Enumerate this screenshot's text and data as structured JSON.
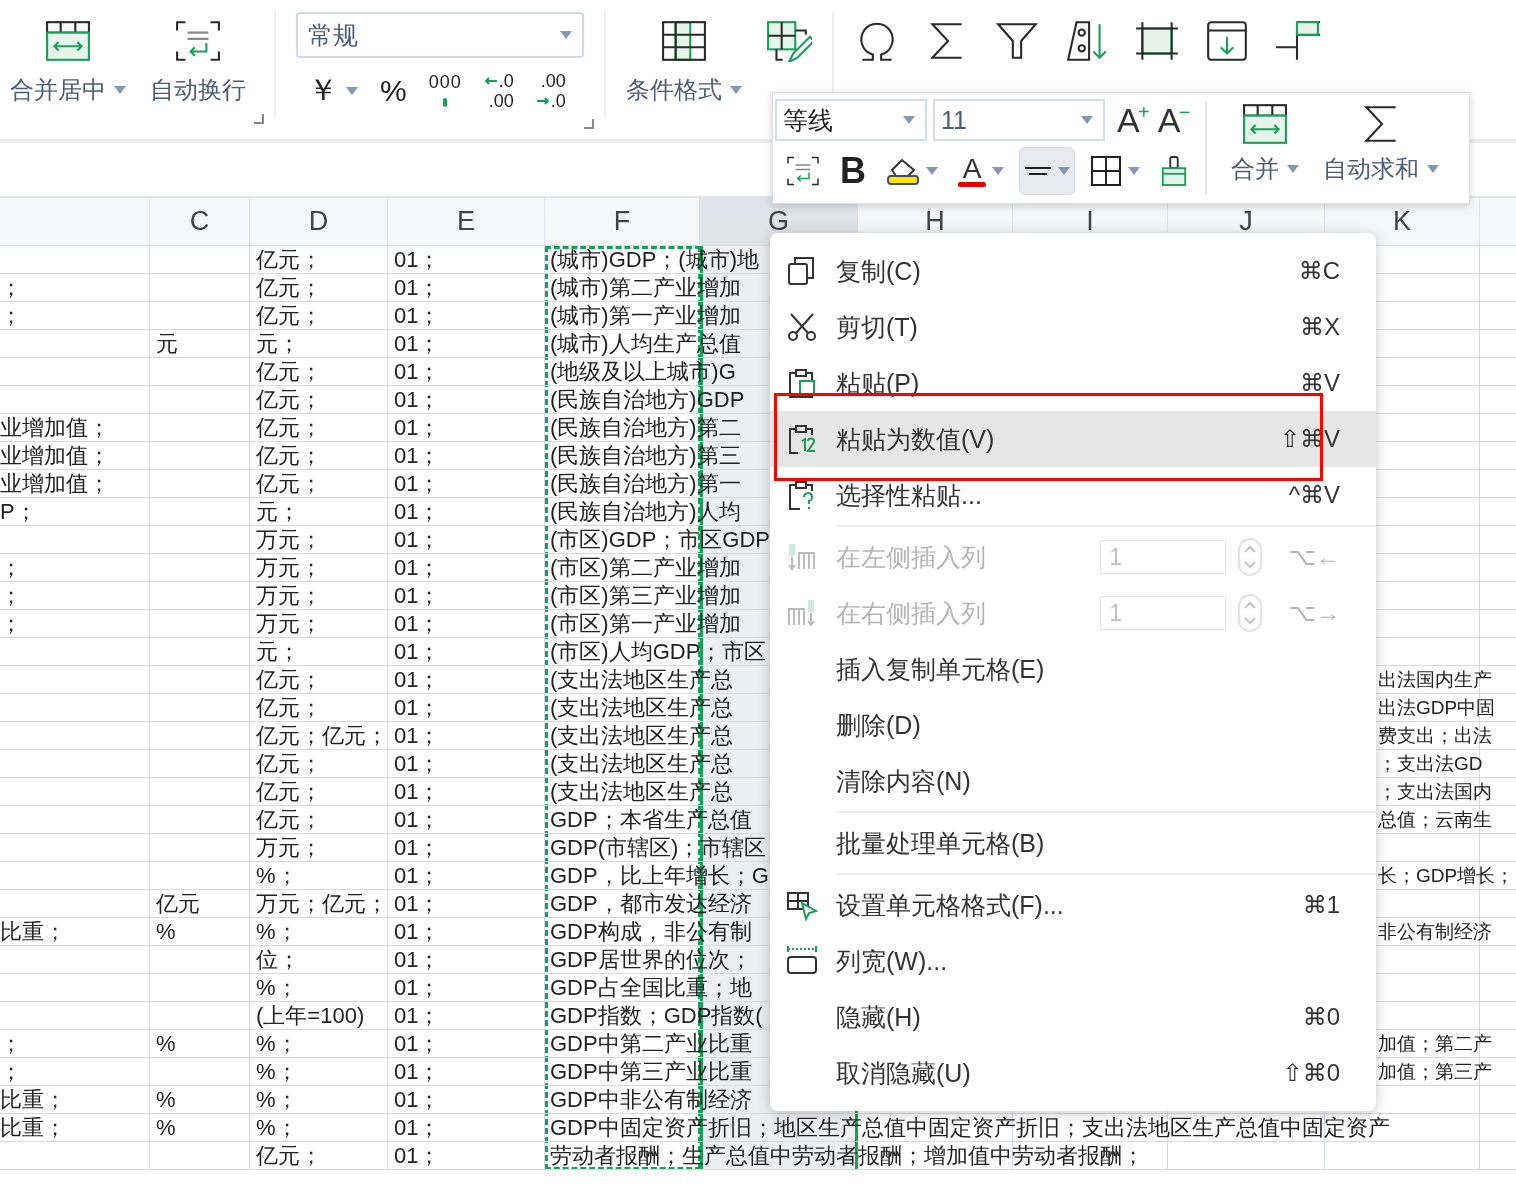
{
  "ribbon": {
    "left_buttons": [
      {
        "kind": "merge",
        "label": "合并居中",
        "dropdown": true
      },
      {
        "kind": "wrap",
        "label": "自动换行",
        "dropdown": false
      }
    ],
    "number_format": {
      "value": "常规",
      "buttons": [
        {
          "kind": "text",
          "text": "￥",
          "dropdown": true
        },
        {
          "kind": "text",
          "text": "%",
          "dropdown": false
        },
        {
          "kind": "thousands",
          "text": "000",
          "dropdown": false
        },
        {
          "kind": "decimal_add",
          "top": ".0",
          "bottom": ".00",
          "dropdown": false
        },
        {
          "kind": "decimal_remove",
          "top": ".00",
          "bottom": ".0",
          "dropdown": false
        }
      ]
    },
    "tools": [
      {
        "kind": "conditional",
        "label": "条件格式",
        "dropdown": true
      },
      {
        "kind": "table_style",
        "dropdown": false
      },
      {
        "kind": "symbol",
        "dropdown": false
      },
      {
        "kind": "sum",
        "dropdown": false
      },
      {
        "kind": "filter",
        "dropdown": false
      },
      {
        "kind": "sort",
        "dropdown": false
      },
      {
        "kind": "format",
        "dropdown": false
      },
      {
        "kind": "fill",
        "dropdown": false
      },
      {
        "kind": "rowcol",
        "dropdown": false
      }
    ]
  },
  "mini_toolbar": {
    "font": "等线",
    "size": "11",
    "size_buttons": [
      {
        "text": "A",
        "sign": "+"
      },
      {
        "text": "A",
        "sign": "−"
      }
    ],
    "tools": [
      {
        "kind": "wrap",
        "dropdown": false,
        "selected": false
      },
      {
        "kind": "bold",
        "text": "B",
        "dropdown": false,
        "selected": false
      },
      {
        "kind": "fill_color",
        "dropdown": true,
        "selected": false
      },
      {
        "kind": "font_color",
        "text": "A",
        "dropdown": true,
        "selected": false
      },
      {
        "kind": "align",
        "dropdown": true,
        "selected": true
      },
      {
        "kind": "borders",
        "dropdown": true,
        "selected": false
      },
      {
        "kind": "painter",
        "dropdown": false,
        "selected": false
      }
    ],
    "big_buttons": [
      {
        "kind": "merge",
        "label": "合并",
        "dropdown": true
      },
      {
        "kind": "sum",
        "label": "自动求和",
        "dropdown": true
      }
    ]
  },
  "sheet": {
    "columns": [
      {
        "label": "C",
        "selected": false,
        "copied": false
      },
      {
        "label": "D",
        "selected": false,
        "copied": false
      },
      {
        "label": "E",
        "selected": false,
        "copied": false
      },
      {
        "label": "F",
        "selected": false,
        "copied": true
      },
      {
        "label": "G",
        "selected": true,
        "copied": false
      },
      {
        "label": "H",
        "selected": false,
        "copied": false
      },
      {
        "label": "I",
        "selected": false,
        "copied": false
      },
      {
        "label": "J",
        "selected": false,
        "copied": false
      },
      {
        "label": "K",
        "selected": false,
        "copied": false
      }
    ],
    "rows": [
      {
        "d": "亿元；",
        "e": "01；",
        "f": "(城市)GDP；(城市)地"
      },
      {
        "b": "；",
        "d": "亿元；",
        "e": "01；",
        "f": "(城市)第二产业增加"
      },
      {
        "b": "；",
        "d": "亿元；",
        "e": "01；",
        "f": "(城市)第一产业增加"
      },
      {
        "c": "元",
        "d": "元；",
        "e": "01；",
        "f": "(城市)人均生产总值"
      },
      {
        "d": "亿元；",
        "e": "01；",
        "f": "(地级及以上城市)G"
      },
      {
        "d": "亿元；",
        "e": "01；",
        "f": "(民族自治地方)GDP"
      },
      {
        "b": "业增加值；",
        "d": "亿元；",
        "e": "01；",
        "f": "(民族自治地方)第二"
      },
      {
        "b": "业增加值；",
        "d": "亿元；",
        "e": "01；",
        "f": "(民族自治地方)第三"
      },
      {
        "b": "业增加值；",
        "d": "亿元；",
        "e": "01；",
        "f": "(民族自治地方)第一"
      },
      {
        "b": "P；",
        "d": "元；",
        "e": "01；",
        "f": "(民族自治地方)人均"
      },
      {
        "d": "万元；",
        "e": "01；",
        "f": "(市区)GDP；市区GDP"
      },
      {
        "b": "；",
        "d": "万元；",
        "e": "01；",
        "f": "(市区)第二产业增加"
      },
      {
        "b": "；",
        "d": "万元；",
        "e": "01；",
        "f": "(市区)第三产业增加"
      },
      {
        "b": "；",
        "d": "万元；",
        "e": "01；",
        "f": "(市区)第一产业增加"
      },
      {
        "d": "元；",
        "e": "01；",
        "f": "(市区)人均GDP；市区"
      },
      {
        "d": "亿元；",
        "e": "01；",
        "f": "(支出法地区生产总",
        "k": "出法国内生产"
      },
      {
        "d": "亿元；",
        "e": "01；",
        "f": "(支出法地区生产总",
        "k": "出法GDP中固"
      },
      {
        "d": "亿元；亿元；",
        "e": "01；",
        "f": "(支出法地区生产总",
        "k": "费支出；出法"
      },
      {
        "d": "亿元；",
        "e": "01；",
        "f": "(支出法地区生产总",
        "k": "；支出法GD"
      },
      {
        "d": "亿元；",
        "e": "01；",
        "f": "(支出法地区生产总",
        "k": "；支出法国内"
      },
      {
        "d": "亿元；",
        "e": "01；",
        "f": "GDP；本省生产总值",
        "k": "总值；云南生"
      },
      {
        "d": "万元；",
        "e": "01；",
        "f": "GDP(市辖区)；市辖区"
      },
      {
        "d": "%；",
        "e": "01；",
        "f": "GDP，比上年增长；G",
        "k": "长；GDP增长；"
      },
      {
        "c": "亿元",
        "d": "万元；亿元；",
        "e": "01；",
        "f": "GDP，都市发达经济"
      },
      {
        "b": "比重；",
        "c": "%",
        "d": "%；",
        "e": "01；",
        "f": "GDP构成，非公有制",
        "k": "非公有制经济"
      },
      {
        "d": "位；",
        "e": "01；",
        "f": "GDP居世界的位次；"
      },
      {
        "d": "%；",
        "e": "01；",
        "f": "GDP占全国比重；地"
      },
      {
        "d": "(上年=100)",
        "e": "01；",
        "f": "GDP指数；GDP指数("
      },
      {
        "b": "；",
        "c": "%",
        "d": "%；",
        "e": "01；",
        "f": "GDP中第二产业比重",
        "k": "加值；第二产"
      },
      {
        "b": "；",
        "d": "%；",
        "e": "01；",
        "f": "GDP中第三产业比重",
        "k": "加值；第三产"
      },
      {
        "b": "比重；",
        "c": "%",
        "d": "%；",
        "e": "01；",
        "f": "GDP中非公有制经济"
      },
      {
        "b": "比重；",
        "c": "%",
        "d": "%；",
        "e": "01；",
        "f": "GDP中固定资产折旧；地区生产总值中固定资产折旧；支出法地区生产总值中固定资产"
      },
      {
        "d": "亿元；",
        "e": "01；",
        "f": "劳动者报酬；生产总值中劳动者报酬；增加值中劳动者报酬；"
      }
    ]
  },
  "context_menu": {
    "items": [
      {
        "kind": "copy",
        "label": "复制(C)",
        "shortcut": "⌘C",
        "selected": false,
        "disabled": false,
        "separator_above": false
      },
      {
        "kind": "cut",
        "label": "剪切(T)",
        "shortcut": "⌘X",
        "selected": false,
        "disabled": false,
        "separator_above": false
      },
      {
        "kind": "paste",
        "label": "粘贴(P)",
        "shortcut": "⌘V",
        "selected": false,
        "disabled": false,
        "separator_above": false
      },
      {
        "kind": "paste_values",
        "label": "粘贴为数值(V)",
        "shortcut": "⇧⌘V",
        "selected": true,
        "disabled": false,
        "separator_above": false
      },
      {
        "kind": "paste_special",
        "label": "选择性粘贴...",
        "shortcut": "^⌘V",
        "selected": false,
        "disabled": false,
        "separator_above": false
      },
      {
        "kind": "insert_left",
        "label": "在左侧插入列",
        "value": "1",
        "shortcut": "⌥←",
        "selected": false,
        "disabled": true,
        "separator_above": true
      },
      {
        "kind": "insert_right",
        "label": "在右侧插入列",
        "value": "1",
        "shortcut": "⌥→",
        "selected": false,
        "disabled": true,
        "separator_above": false
      },
      {
        "kind": "plain",
        "label": "插入复制单元格(E)",
        "selected": false,
        "disabled": false,
        "separator_above": false
      },
      {
        "kind": "plain",
        "label": "删除(D)",
        "selected": false,
        "disabled": false,
        "separator_above": false
      },
      {
        "kind": "plain",
        "label": "清除内容(N)",
        "selected": false,
        "disabled": false,
        "separator_above": false
      },
      {
        "kind": "plain",
        "label": "批量处理单元格(B)",
        "selected": false,
        "disabled": false,
        "separator_above": true
      },
      {
        "kind": "format_cells",
        "label": "设置单元格格式(F)...",
        "shortcut": "⌘1",
        "selected": false,
        "disabled": false,
        "separator_above": true
      },
      {
        "kind": "column_width",
        "label": "列宽(W)...",
        "selected": false,
        "disabled": false,
        "separator_above": false
      },
      {
        "kind": "plain",
        "label": "隐藏(H)",
        "shortcut": "⌘0",
        "selected": false,
        "disabled": false,
        "separator_above": false
      },
      {
        "kind": "plain",
        "label": "取消隐藏(U)",
        "shortcut": "⇧⌘0",
        "selected": false,
        "disabled": false,
        "separator_above": false
      }
    ]
  }
}
